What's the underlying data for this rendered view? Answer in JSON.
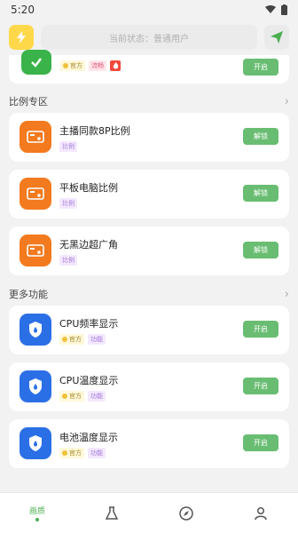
{
  "status_bar": {
    "time": "5:20"
  },
  "header": {
    "status_text": "当前状态：普通用户"
  },
  "top_card": {
    "tags": [
      "官方",
      "流畅"
    ],
    "button": "开启"
  },
  "ratio_section": {
    "title": "比例专区",
    "items": [
      {
        "title": "主播同款8P比例",
        "tag": "比例",
        "button": "解锁"
      },
      {
        "title": "平板电脑比例",
        "tag": "比例",
        "button": "解锁"
      },
      {
        "title": "无黑边超广角",
        "tag": "比例",
        "button": "解锁"
      }
    ]
  },
  "more_section": {
    "title": "更多功能",
    "items": [
      {
        "title": "CPU频率显示",
        "tags": [
          "官方",
          "功能"
        ],
        "button": "开启"
      },
      {
        "title": "CPU温度显示",
        "tags": [
          "官方",
          "功能"
        ],
        "button": "开启"
      },
      {
        "title": "电池温度显示",
        "tags": [
          "官方",
          "功能"
        ],
        "button": "开启"
      }
    ]
  },
  "bottom_nav": {
    "home_label": "画质"
  },
  "colors": {
    "green": "#69bd72",
    "orange": "#f37a1e",
    "blue": "#2b6fe6"
  }
}
